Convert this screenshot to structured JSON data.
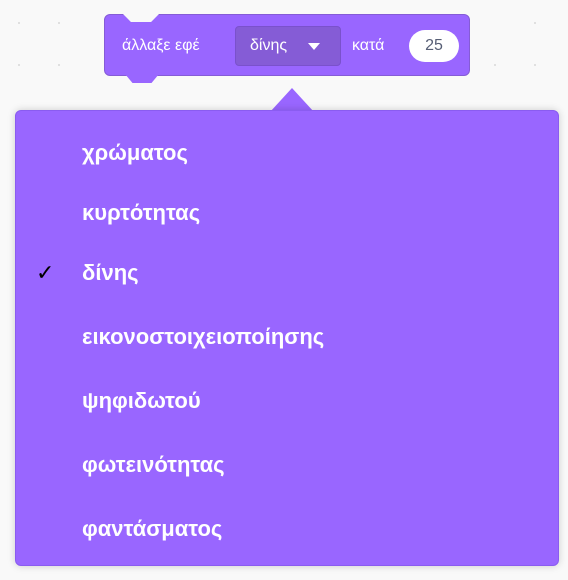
{
  "block": {
    "prefix_label": "άλλαξε εφέ",
    "selected_effect": "δίνης",
    "suffix_label": "κατά",
    "amount": "25"
  },
  "menu": {
    "check_glyph": "✓",
    "items": [
      {
        "label": "χρώματος",
        "checked": false
      },
      {
        "label": "κυρτότητας",
        "checked": false
      },
      {
        "label": "δίνης",
        "checked": true
      },
      {
        "label": "εικονοστοιχειοποίησης",
        "checked": false
      },
      {
        "label": "ψηφιδωτού",
        "checked": false
      },
      {
        "label": "φωτεινότητας",
        "checked": false
      },
      {
        "label": "φαντάσματος",
        "checked": false
      }
    ]
  },
  "colors": {
    "block_fill": "#9966ff",
    "dropdown_field": "#855cd6",
    "menu_fill": "#9966ff",
    "text": "#ffffff",
    "number_text": "#575e75"
  },
  "icons": {
    "dropdown_arrow": "caret-down-icon",
    "checkmark": "checkmark-icon"
  }
}
